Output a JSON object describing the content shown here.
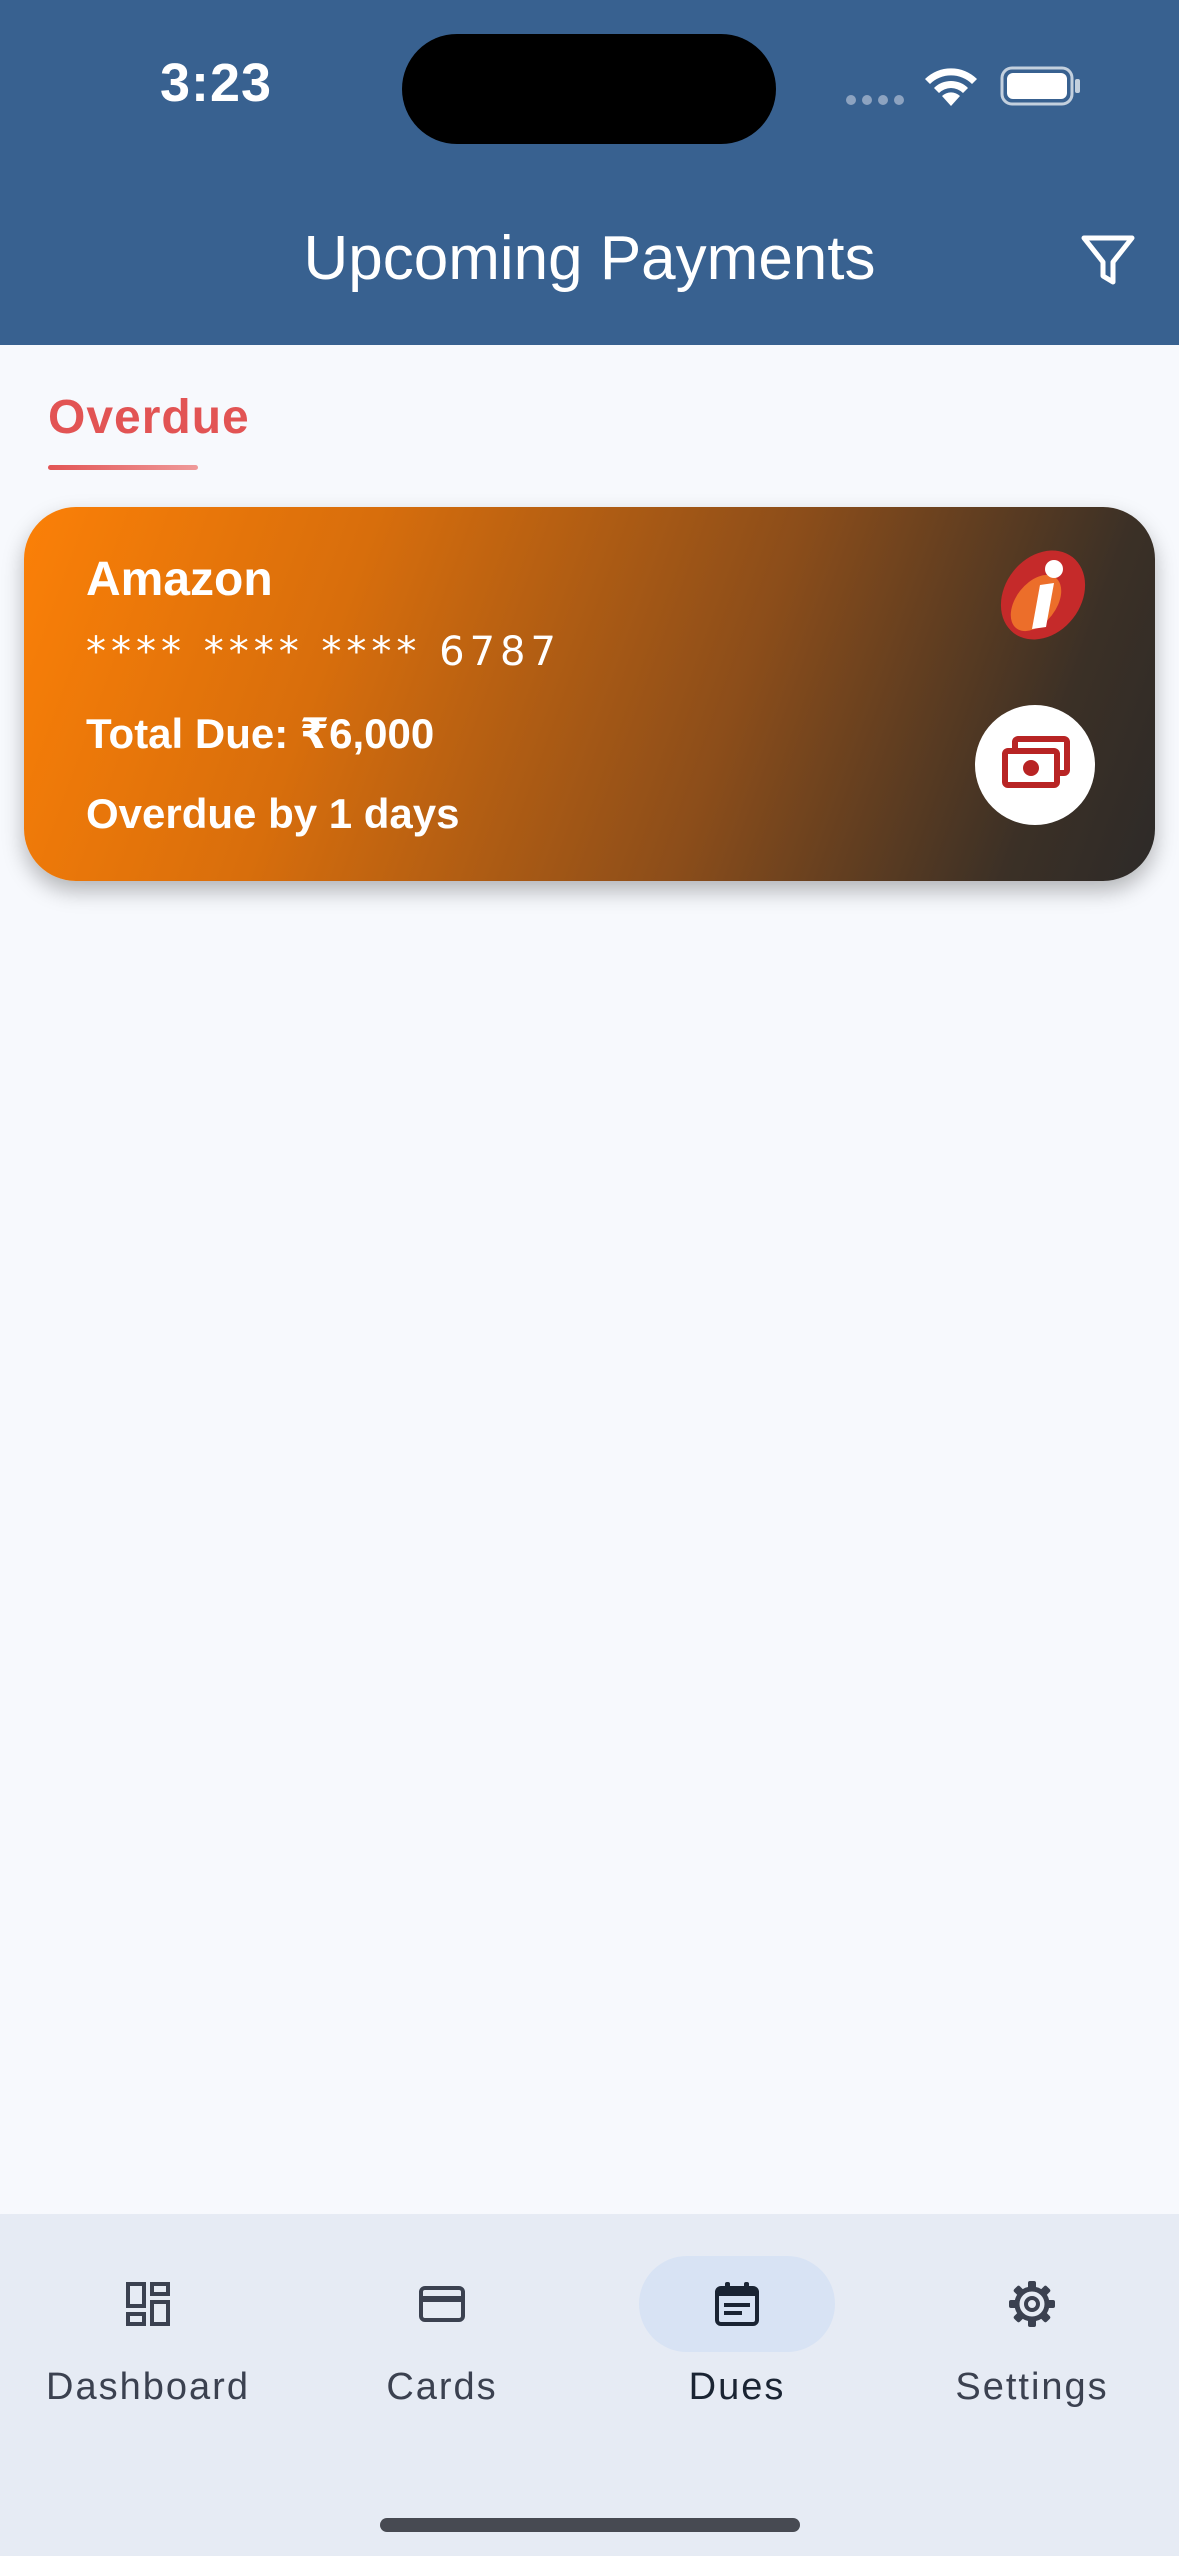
{
  "status_bar": {
    "time": "3:23"
  },
  "header": {
    "title": "Upcoming Payments",
    "filter_icon": "filter-icon",
    "background_color": "#386190"
  },
  "tabs": {
    "active_label": "Overdue",
    "active_color": "#e25454"
  },
  "cards": [
    {
      "name": "Amazon",
      "number": "**** **** **** 6787",
      "total_due": "Total Due: ₹6,000",
      "overdue_text": "Overdue by 1 days",
      "bank_logo_icon": "bank-logo-icon",
      "pay_icon": "pay-money-icon",
      "gradient_start": "#fb8007",
      "gradient_end": "#2d2a28"
    }
  ],
  "bottom_nav": {
    "items": [
      {
        "label": "Dashboard",
        "icon": "dashboard-icon",
        "active": false
      },
      {
        "label": "Cards",
        "icon": "credit-card-icon",
        "active": false
      },
      {
        "label": "Dues",
        "icon": "calendar-icon",
        "active": true
      },
      {
        "label": "Settings",
        "icon": "gear-icon",
        "active": false
      }
    ]
  }
}
